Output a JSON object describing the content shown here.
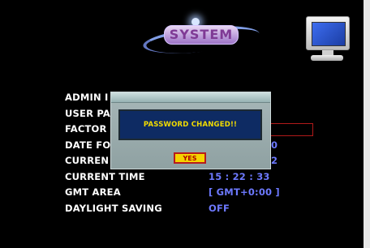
{
  "header": {
    "logo_text": "SYSTEM",
    "monitor_icon": "monitor-icon"
  },
  "settings": {
    "rows": [
      {
        "label": "ADMIN I",
        "value": ""
      },
      {
        "label": "USER PA",
        "value": ""
      },
      {
        "label": "FACTOR",
        "value": ""
      },
      {
        "label": "DATE FO",
        "value": "0"
      },
      {
        "label": "CURREN",
        "value": "2"
      },
      {
        "label": "CURRENT TIME",
        "value": "15 : 22 : 33"
      },
      {
        "label": "GMT AREA",
        "value": "[ GMT+0:00 ]"
      },
      {
        "label": "DAYLIGHT SAVING",
        "value": "OFF"
      }
    ]
  },
  "dialog": {
    "message": "PASSWORD CHANGED!!",
    "yes_label": "YES"
  },
  "colors": {
    "background": "#000000",
    "label": "#ffffff",
    "value": "#6d79ff",
    "dialog_message": "#f2dc00",
    "yes_button": "#f5d300",
    "yes_border": "#b71c1c"
  }
}
